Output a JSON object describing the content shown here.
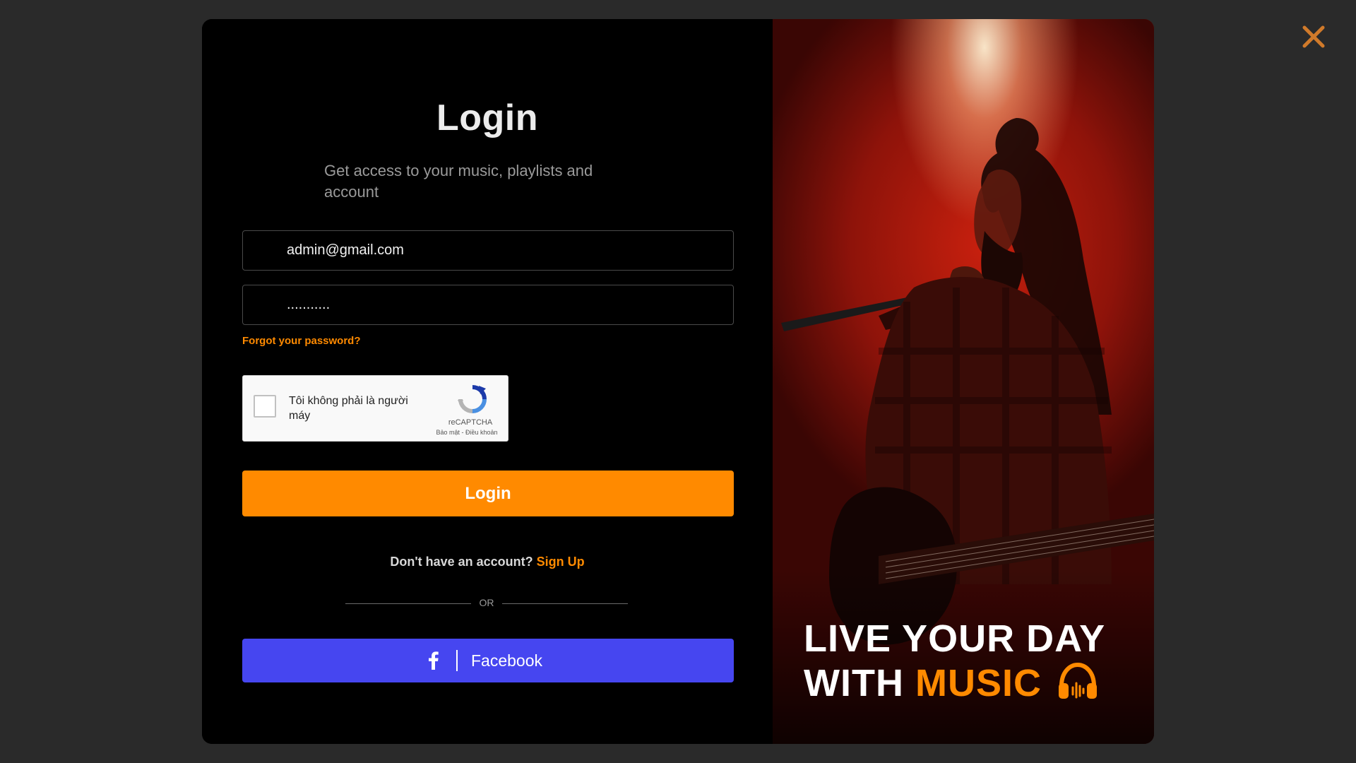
{
  "close": {
    "icon": "close-icon",
    "color": "#d07a2a"
  },
  "login": {
    "title": "Login",
    "subtitle": "Get access to your music, playlists and account",
    "email_value": "admin@gmail.com",
    "password_value": "...........",
    "forgot_label": "Forgot your password?",
    "captcha": {
      "label": "Tôi không phải là người máy",
      "brand": "reCAPTCHA",
      "links": "Bảo mật - Điều khoản"
    },
    "submit_label": "Login",
    "signup_prompt": "Don't have an account?",
    "signup_link": "Sign Up",
    "or_label": "OR",
    "facebook_label": "Facebook"
  },
  "promo": {
    "line1": "LIVE YOUR DAY",
    "line2_prefix": "WITH",
    "line2_accent": "MUSIC",
    "icon": "headphones-icon"
  },
  "colors": {
    "accent": "#ff8a00",
    "facebook": "#4646f0",
    "background": "#2a2a2a"
  }
}
